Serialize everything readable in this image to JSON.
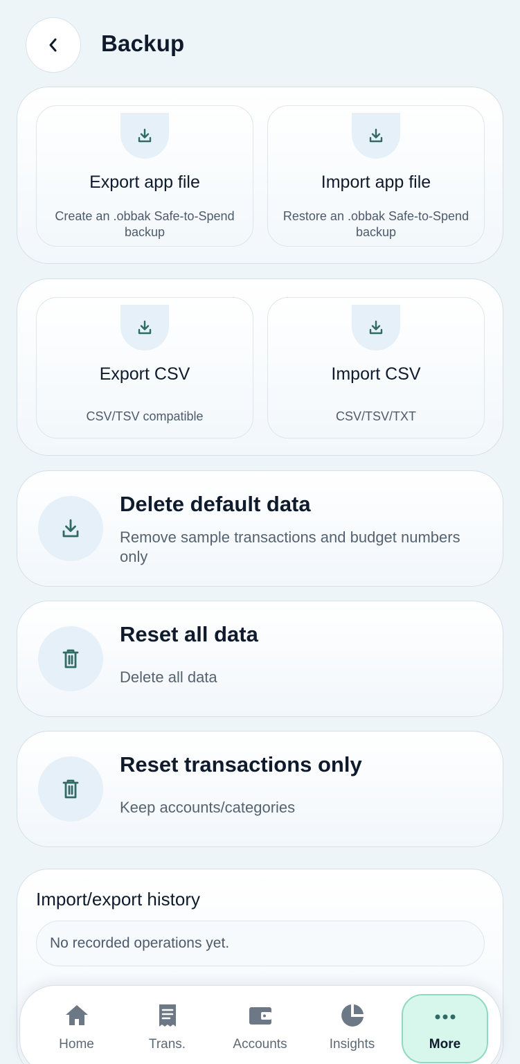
{
  "header": {
    "title": "Backup"
  },
  "app_file_group": {
    "tiles": [
      {
        "title": "Export app file",
        "subtitle": "Create an .obbak Safe-to-Spend backup",
        "icon": "download-icon"
      },
      {
        "title": "Import app file",
        "subtitle": "Restore an .obbak Safe-to-Spend backup",
        "icon": "download-icon"
      }
    ]
  },
  "csv_group": {
    "tiles": [
      {
        "title": "Export CSV",
        "subtitle": "CSV/TSV compatible",
        "icon": "download-icon"
      },
      {
        "title": "Import CSV",
        "subtitle": "CSV/TSV/TXT",
        "icon": "download-icon"
      }
    ]
  },
  "actions": [
    {
      "title": "Delete default data",
      "subtitle": "Remove sample transactions and budget numbers only",
      "icon": "download-icon"
    },
    {
      "title": "Reset all data",
      "subtitle": "Delete all data",
      "icon": "trash-icon"
    },
    {
      "title": "Reset transactions only",
      "subtitle": "Keep accounts/categories",
      "icon": "trash-icon"
    }
  ],
  "history": {
    "title": "Import/export history",
    "empty_text": "No recorded operations yet."
  },
  "nav": {
    "items": [
      {
        "label": "Home",
        "icon": "home-icon"
      },
      {
        "label": "Trans.",
        "icon": "receipt-icon"
      },
      {
        "label": "Accounts",
        "icon": "wallet-icon"
      },
      {
        "label": "Insights",
        "icon": "pie-chart-icon"
      },
      {
        "label": "More",
        "icon": "more-dots-icon",
        "active": true
      }
    ]
  },
  "colors": {
    "accent_teal": "#2f6b64",
    "icon_bubble": "#e6f0f8",
    "nav_active_bg": "#d8f7ec",
    "nav_icon": "#6c7886"
  }
}
